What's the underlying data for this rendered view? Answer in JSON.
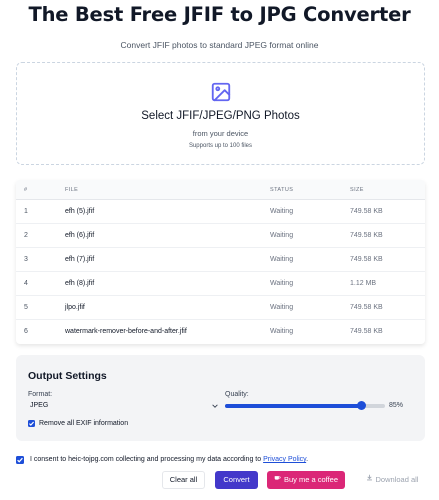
{
  "header": {
    "title": "The Best Free JFIF to JPG Converter",
    "subtitle": "Convert JFIF photos to standard JPEG format online"
  },
  "dropzone": {
    "icon": "image-icon",
    "title": "Select JFIF/JPEG/PNG Photos",
    "subtitle": "from your device",
    "limit": "Supports up to 100 files"
  },
  "table": {
    "headers": {
      "num": "#",
      "file": "FILE",
      "status": "STATUS",
      "size": "SIZE"
    },
    "rows": [
      {
        "num": "1",
        "file": "efh (5).jfif",
        "status": "Waiting",
        "size": "749.58 KB"
      },
      {
        "num": "2",
        "file": "efh (6).jfif",
        "status": "Waiting",
        "size": "749.58 KB"
      },
      {
        "num": "3",
        "file": "efh (7).jfif",
        "status": "Waiting",
        "size": "749.58 KB"
      },
      {
        "num": "4",
        "file": "efh (8).jfif",
        "status": "Waiting",
        "size": "1.12 MB"
      },
      {
        "num": "5",
        "file": "jlpo.jfif",
        "status": "Waiting",
        "size": "749.58 KB"
      },
      {
        "num": "6",
        "file": "watermark-remover-before-and-after.jfif",
        "status": "Waiting",
        "size": "749.58 KB"
      }
    ]
  },
  "settings": {
    "title": "Output Settings",
    "format_label": "Format:",
    "format_value": "JPEG",
    "quality_label": "Quality:",
    "quality_value": "85%",
    "quality_fraction": 0.85,
    "exif_label": "Remove all EXIF information",
    "exif_checked": true
  },
  "consent": {
    "checked": true,
    "text": "I consent to heic-tojpg.com collecting and processing my data according to",
    "link": "Privacy Policy",
    "suffix": "."
  },
  "actions": {
    "clear": "Clear all",
    "convert": "Convert",
    "coffee": "Buy me a coffee",
    "download": "Download all"
  },
  "colors": {
    "accent": "#1d4ed8",
    "convert": "#4338ca",
    "coffee": "#db2777",
    "icon": "#6366f1"
  }
}
